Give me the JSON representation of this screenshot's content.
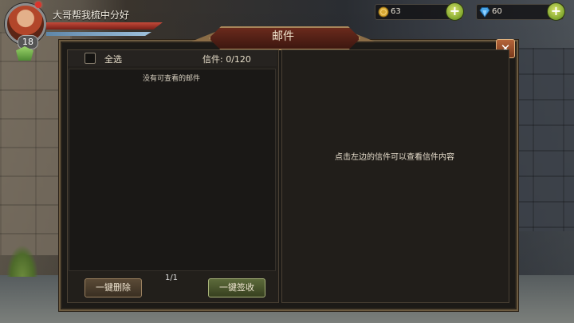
{
  "player": {
    "name": "大哥帮我梳中分好",
    "level": "18"
  },
  "currency": {
    "gold": "63",
    "diamond": "60",
    "plus": "+"
  },
  "dialog": {
    "title": "邮件",
    "close": "✕",
    "select_all": "全选",
    "mail_count": "信件: 0/120",
    "empty_message": "没有可查看的邮件",
    "page": "1/1",
    "delete_all": "一键删除",
    "collect_all": "一键签收",
    "detail_hint": "点击左边的信件可以查看信件内容"
  },
  "colors": {
    "panel_border": "#6d5b40",
    "title_plate": "#6a2a1c",
    "plus_green": "#7ea52c"
  }
}
